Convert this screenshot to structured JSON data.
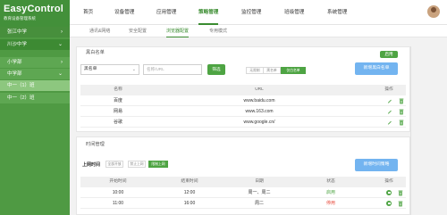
{
  "brand": {
    "title": "EasyControl",
    "subtitle": "教育设备管理系统"
  },
  "sidebar": {
    "items": [
      {
        "label": "张江中学",
        "chevron": "›",
        "kind": "school"
      },
      {
        "label": "川沙中学",
        "chevron": "⌄",
        "kind": "school-active"
      },
      {
        "label": "小学部",
        "chevron": "›",
        "kind": "class"
      },
      {
        "label": "中学部",
        "chevron": "⌄",
        "kind": "class"
      },
      {
        "label": "中一（1）班",
        "chevron": "",
        "kind": "class-active"
      },
      {
        "label": "中一（2）班",
        "chevron": "",
        "kind": "class"
      }
    ]
  },
  "nav": {
    "items": [
      "首页",
      "设备管理",
      "应用管理",
      "策略管理",
      "监控管理",
      "班级管理",
      "系统管理"
    ],
    "active_index": 3
  },
  "subtabs": {
    "items": [
      "通讯&网络",
      "安全配置",
      "浏览器配置",
      "专用模式"
    ],
    "active_index": 2
  },
  "blacklist": {
    "title": "黑白名单",
    "enable_label": "启用",
    "select_value": "黑名单",
    "input_placeholder": "名称/URL",
    "filter_label": "筛选",
    "segments": [
      "无限制",
      "黑名单",
      "仅白名单"
    ],
    "active_segment": 2,
    "new_button": "新增黑白名单",
    "headers": [
      "名称",
      "URL",
      "操作"
    ],
    "rows": [
      {
        "name": "百度",
        "url": "www.baidu.com"
      },
      {
        "name": "网易",
        "url": "www.163.com"
      },
      {
        "name": "谷歌",
        "url": "www.google.cn/"
      }
    ]
  },
  "time": {
    "title": "时间管理",
    "online_label": "上网时间",
    "segments": [
      "全部开放",
      "禁止上网",
      "限制上网"
    ],
    "active_segment": 2,
    "new_button": "新增时间策略",
    "headers": [
      "开始时间",
      "结束时间",
      "日期",
      "状态",
      "操作"
    ],
    "rows": [
      {
        "start": "10:00",
        "end": "12:00",
        "date": "周一、周二",
        "status": "启用",
        "status_kind": "on"
      },
      {
        "start": "11:00",
        "end": "16:00",
        "date": "周二",
        "status": "停用",
        "status_kind": "off"
      }
    ]
  },
  "colors": {
    "sidebar": "#4f9a43",
    "accent": "#3a8c30",
    "button_green": "#4ea443",
    "button_blue": "#73b4f0",
    "danger": "#e84c3d"
  }
}
